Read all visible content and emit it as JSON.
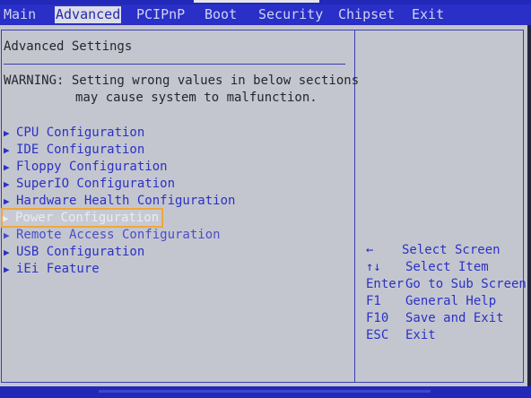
{
  "menu": {
    "items": [
      {
        "label": "Main"
      },
      {
        "label": "Advanced",
        "active": true
      },
      {
        "label": "PCIPnP"
      },
      {
        "label": "Boot"
      },
      {
        "label": "Security"
      },
      {
        "label": "Chipset"
      },
      {
        "label": "Exit"
      }
    ]
  },
  "main": {
    "section_title": "Advanced Settings",
    "warning_line1": "WARNING: Setting wrong values in below sections",
    "warning_line2": "may cause system to malfunction.",
    "items": [
      {
        "label": "CPU Configuration"
      },
      {
        "label": "IDE Configuration"
      },
      {
        "label": "Floppy Configuration"
      },
      {
        "label": "SuperIO Configuration"
      },
      {
        "label": "Hardware Health Configuration"
      },
      {
        "label": "Power Configuration",
        "selected": true
      },
      {
        "label": "Remote Access Configuration"
      },
      {
        "label": "USB Configuration"
      },
      {
        "label": "iEi Feature"
      }
    ]
  },
  "help": {
    "keys": [
      {
        "key": "←",
        "desc": "Select Screen"
      },
      {
        "key": "↑↓",
        "desc": "Select Item"
      },
      {
        "key": "Enter",
        "desc": "Go to Sub Screen"
      },
      {
        "key": "F1",
        "desc": "General Help"
      },
      {
        "key": "F10",
        "desc": "Save and Exit"
      },
      {
        "key": "ESC",
        "desc": "Exit"
      }
    ]
  },
  "colors": {
    "menubar": "#2a2fc8",
    "panel": "#c4c6cf",
    "text_blue": "#2a32c4",
    "highlight_outline": "#f0a63a"
  },
  "icons": {
    "submenu_arrow": "triangle-right-icon"
  }
}
